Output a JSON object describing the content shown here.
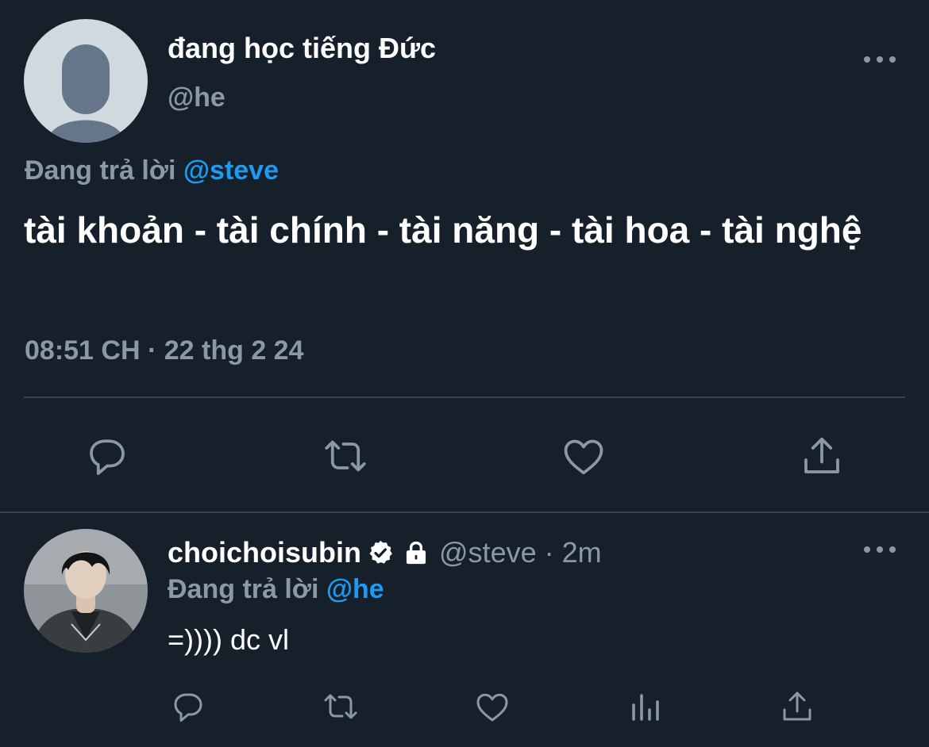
{
  "tweet": {
    "display_name": "đang học tiếng Đức",
    "handle": "@he",
    "reply_prefix": "Đang trả lời",
    "reply_to": "@steve",
    "body": "tài khoản - tài chính - tài năng - tài hoa - tài nghệ",
    "time": "08:51 CH",
    "separator": "·",
    "date": "22 thg 2 24",
    "actions": [
      "comment-icon",
      "retweet-icon",
      "like-icon",
      "share-icon"
    ]
  },
  "reply": {
    "display_name": "choichoisubin",
    "handle": "@steve",
    "separator": "·",
    "time": "2m",
    "reply_prefix": "Đang trả lời",
    "reply_to": "@he",
    "body": "=)))) dc vl",
    "badges": [
      "verified-icon",
      "lock-icon"
    ],
    "actions": [
      "comment-icon",
      "retweet-icon",
      "like-icon",
      "analytics-icon",
      "share-icon"
    ]
  },
  "colors": {
    "background": "#15202b",
    "text": "#ffffff",
    "muted": "#8b98a5",
    "accent": "#1d9bf0",
    "divider": "#38444d"
  }
}
